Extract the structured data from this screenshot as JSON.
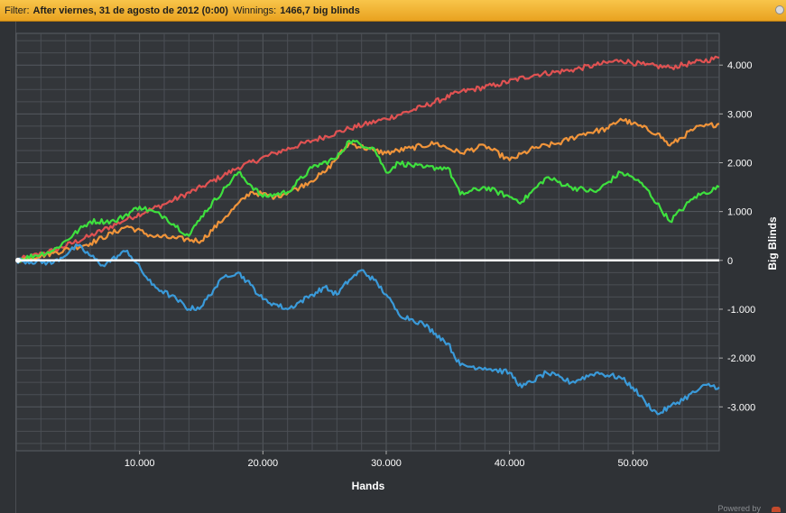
{
  "filter": {
    "filter_label": "Filter:",
    "filter_value": "After viernes, 31 de agosto de 2012 (0:00)",
    "winnings_label": "Winnings:",
    "winnings_value": "1466,7 big blinds"
  },
  "footer": {
    "powered_text": "Powered by"
  },
  "colors": {
    "background": "#2f3236",
    "plot_background": "#33363a",
    "grid": "#4b4f55",
    "zero_line": "#ffffff",
    "axis_text": "#ffffff",
    "filter_bar": "#f0b030"
  },
  "chart_data": {
    "type": "line",
    "title": "",
    "xlabel": "Hands",
    "ylabel": "Big Blinds",
    "xlim": [
      0,
      57000
    ],
    "ylim": [
      -3900,
      4650
    ],
    "x_ticks": [
      10000,
      20000,
      30000,
      40000,
      50000
    ],
    "x_tick_labels": [
      "10.000",
      "20.000",
      "30.000",
      "40.000",
      "50.000"
    ],
    "y_ticks": [
      4000,
      3000,
      2000,
      1000,
      0,
      -1000,
      -2000,
      -3000
    ],
    "y_tick_labels": [
      "4.000",
      "3.000",
      "2.000",
      "1.000",
      "0",
      "-1.000",
      "-2.000",
      "-3.000"
    ],
    "grid": true,
    "y_axis_position": "right",
    "series": [
      {
        "color": "#e05252",
        "x": [
          0,
          3000,
          6000,
          9000,
          12000,
          15000,
          18000,
          21000,
          24000,
          27000,
          30000,
          33000,
          36000,
          39000,
          42000,
          45000,
          47000,
          49000,
          51000,
          53000,
          55000,
          57000
        ],
        "values": [
          0,
          200,
          500,
          850,
          1150,
          1500,
          1900,
          2200,
          2450,
          2700,
          2900,
          3150,
          3450,
          3600,
          3800,
          3900,
          4000,
          4100,
          4000,
          3950,
          4050,
          4150
        ]
      },
      {
        "color": "#f0943a",
        "x": [
          0,
          3000,
          6000,
          9000,
          11000,
          13000,
          15000,
          17000,
          19000,
          21000,
          23000,
          25000,
          27000,
          29000,
          30000,
          32000,
          34000,
          36000,
          38000,
          40000,
          42000,
          44000,
          46000,
          48000,
          49000,
          50000,
          52000,
          53000,
          55000,
          57000
        ],
        "values": [
          0,
          150,
          350,
          700,
          500,
          450,
          400,
          900,
          1400,
          1300,
          1500,
          1800,
          2400,
          2250,
          2200,
          2300,
          2400,
          2200,
          2350,
          2050,
          2300,
          2400,
          2600,
          2700,
          2900,
          2800,
          2600,
          2350,
          2700,
          2800
        ]
      },
      {
        "color": "#3ee03e",
        "x": [
          0,
          3000,
          6000,
          8000,
          10000,
          12000,
          14000,
          15000,
          17000,
          18000,
          20000,
          22000,
          24000,
          26000,
          27000,
          29000,
          30000,
          31000,
          33000,
          35000,
          36000,
          38000,
          40000,
          41000,
          43000,
          45000,
          47000,
          49000,
          50000,
          51000,
          53000,
          55000,
          57000
        ],
        "values": [
          0,
          200,
          800,
          800,
          1100,
          900,
          500,
          900,
          1500,
          1800,
          1300,
          1400,
          1900,
          2100,
          2450,
          2300,
          1800,
          2000,
          1900,
          1900,
          1350,
          1500,
          1300,
          1200,
          1700,
          1500,
          1400,
          1800,
          1700,
          1500,
          800,
          1300,
          1500
        ]
      },
      {
        "color": "#3a9ad9",
        "x": [
          0,
          3000,
          5000,
          7000,
          9000,
          11000,
          13000,
          14000,
          15000,
          16000,
          17000,
          18000,
          19000,
          20000,
          21000,
          22000,
          24000,
          25000,
          26000,
          27000,
          28000,
          29000,
          30000,
          31000,
          32000,
          33000,
          34000,
          35000,
          36000,
          38000,
          40000,
          41000,
          43000,
          45000,
          47000,
          49000,
          50000,
          51000,
          52000,
          53000,
          55000,
          56000,
          57000
        ],
        "values": [
          0,
          -50,
          300,
          -100,
          200,
          -500,
          -800,
          -1000,
          -950,
          -600,
          -300,
          -250,
          -500,
          -800,
          -900,
          -1000,
          -700,
          -550,
          -700,
          -400,
          -200,
          -400,
          -700,
          -1100,
          -1200,
          -1300,
          -1500,
          -1700,
          -2150,
          -2200,
          -2300,
          -2600,
          -2300,
          -2500,
          -2300,
          -2400,
          -2600,
          -2900,
          -3150,
          -3000,
          -2700,
          -2550,
          -2600
        ]
      }
    ]
  }
}
